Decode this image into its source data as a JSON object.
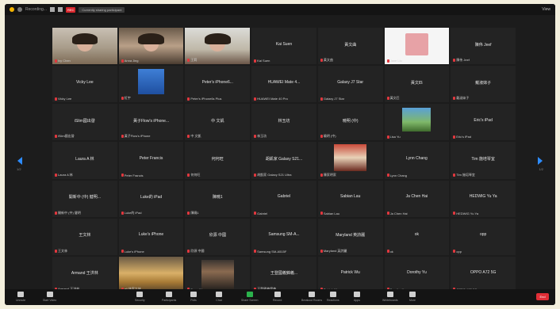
{
  "topbar": {
    "title": "Recording...",
    "rec": "REC",
    "pill": "Currently sharing participant",
    "view": "View"
  },
  "grid": {
    "tiles": [
      {
        "name": "",
        "label": "Ivy Chen",
        "video": "person1"
      },
      {
        "name": "",
        "label": "Anna Jing",
        "video": "person2"
      },
      {
        "name": "",
        "label": "王莉",
        "video": "person3"
      },
      {
        "name": "Kai Suen",
        "label": "Kai Suen"
      },
      {
        "name": "黃文曲",
        "label": "黃文曲"
      },
      {
        "name": "",
        "label": "Jane Liu",
        "video": "person4"
      },
      {
        "name": "陳伟 Jeef",
        "label": "陳伟 Jeef"
      },
      {
        "name": "Vicky Lee",
        "label": "Vicky Lee"
      },
      {
        "name": "",
        "label": "紅宇",
        "video": "poster"
      },
      {
        "name": "Peter's iPhone6...",
        "label": "Peter's iPhone6s Plus"
      },
      {
        "name": "HUAWEI Mate 4...",
        "label": "HUAWEI Mate 40 Pro"
      },
      {
        "name": "Galaxy J7 Star",
        "label": "Galaxy J7 Star"
      },
      {
        "name": "黃文匹",
        "label": "黃文匹"
      },
      {
        "name": "戴淑妹子",
        "label": "戴淑妹子"
      },
      {
        "name": "iSlim國出發",
        "label": "iSlim國出發"
      },
      {
        "name": "黃子Flow's iPhone...",
        "label": "黃子Flow's iPhone"
      },
      {
        "name": "中 文凱",
        "label": "中 文凱"
      },
      {
        "name": "林玉坊",
        "label": "林玉坊"
      },
      {
        "name": "曉明 (中)",
        "label": "曉明 (中)"
      },
      {
        "name": "",
        "label": "Lisa Yu",
        "video": "landscape"
      },
      {
        "name": "Eric's iPad",
        "label": "Eric's iPad"
      },
      {
        "name": "Laura A 林",
        "label": "Laura A 林"
      },
      {
        "name": "Peter Francis",
        "label": "Peter Francis"
      },
      {
        "name": "何何旺",
        "label": "何何旺"
      },
      {
        "name": "胡凱家 Galaxy S21...",
        "label": "胡凱家 Galaxy S21 Ultra"
      },
      {
        "name": "",
        "label": "陳家明家",
        "video": "group"
      },
      {
        "name": "Lynn Chang",
        "label": "Lynn Chang"
      },
      {
        "name": "Tim 施培琴宜",
        "label": "Tim 施培琴宜"
      },
      {
        "name": "開新中 (中) 健明...",
        "label": "開新中 (中) 健明"
      },
      {
        "name": "Luke的 iPad",
        "label": "Luke的 iPad"
      },
      {
        "name": "陳曉1",
        "label": "陳曉1"
      },
      {
        "name": "Gabriel",
        "label": "Gabriel"
      },
      {
        "name": "Sabian Lau",
        "label": "Sabian Lau"
      },
      {
        "name": "Ja Chen Hai",
        "label": "Ja Chen Hai"
      },
      {
        "name": "HEDWIG Yu Ya",
        "label": "HEDWIG Yu Ya"
      },
      {
        "name": "王文林",
        "label": "王文林"
      },
      {
        "name": "Luke's iPhone",
        "label": "Luke's iPhone"
      },
      {
        "name": "欣源 中國",
        "label": "欣源 中國"
      },
      {
        "name": "Samsung SM-A...",
        "label": "Samsung SM-A515F"
      },
      {
        "name": "Maryland 英詩麗",
        "label": "Maryland 英詩麗"
      },
      {
        "name": "ok",
        "label": "ok"
      },
      {
        "name": "opp",
        "label": "opp"
      },
      {
        "name": "Armand 王洪林",
        "label": "Armand 王洪林"
      },
      {
        "name": "",
        "label": "ali 林家大妹",
        "video": "sunset"
      },
      {
        "name": "",
        "label": "Dave Wang",
        "video": "person5"
      },
      {
        "name": "王登國義錦義...",
        "label": "王登國義錦義"
      },
      {
        "name": "Patrick Wu",
        "label": "Patrick Wu"
      },
      {
        "name": "Dorothy Yu",
        "label": "Dorothy Yu"
      },
      {
        "name": "OPPO A72 5G",
        "label": "OPPO A72 5G"
      }
    ]
  },
  "pages": {
    "left": "1/2",
    "right": "1/2"
  },
  "toolbar": {
    "items": [
      {
        "label": "Unmute",
        "color": "normal"
      },
      {
        "label": "Start Video",
        "color": "normal"
      },
      {
        "label": "Security",
        "color": "normal"
      },
      {
        "label": "Participants",
        "color": "normal"
      },
      {
        "label": "Polls",
        "color": "normal"
      },
      {
        "label": "Chat",
        "color": "normal"
      },
      {
        "label": "Share Screen",
        "color": "green"
      },
      {
        "label": "Record",
        "color": "normal"
      },
      {
        "label": "Breakout Rooms",
        "color": "normal"
      },
      {
        "label": "Reactions",
        "color": "normal"
      },
      {
        "label": "Apps",
        "color": "normal"
      },
      {
        "label": "Whiteboards",
        "color": "normal"
      },
      {
        "label": "More",
        "color": "normal"
      }
    ],
    "end_label": "End"
  }
}
